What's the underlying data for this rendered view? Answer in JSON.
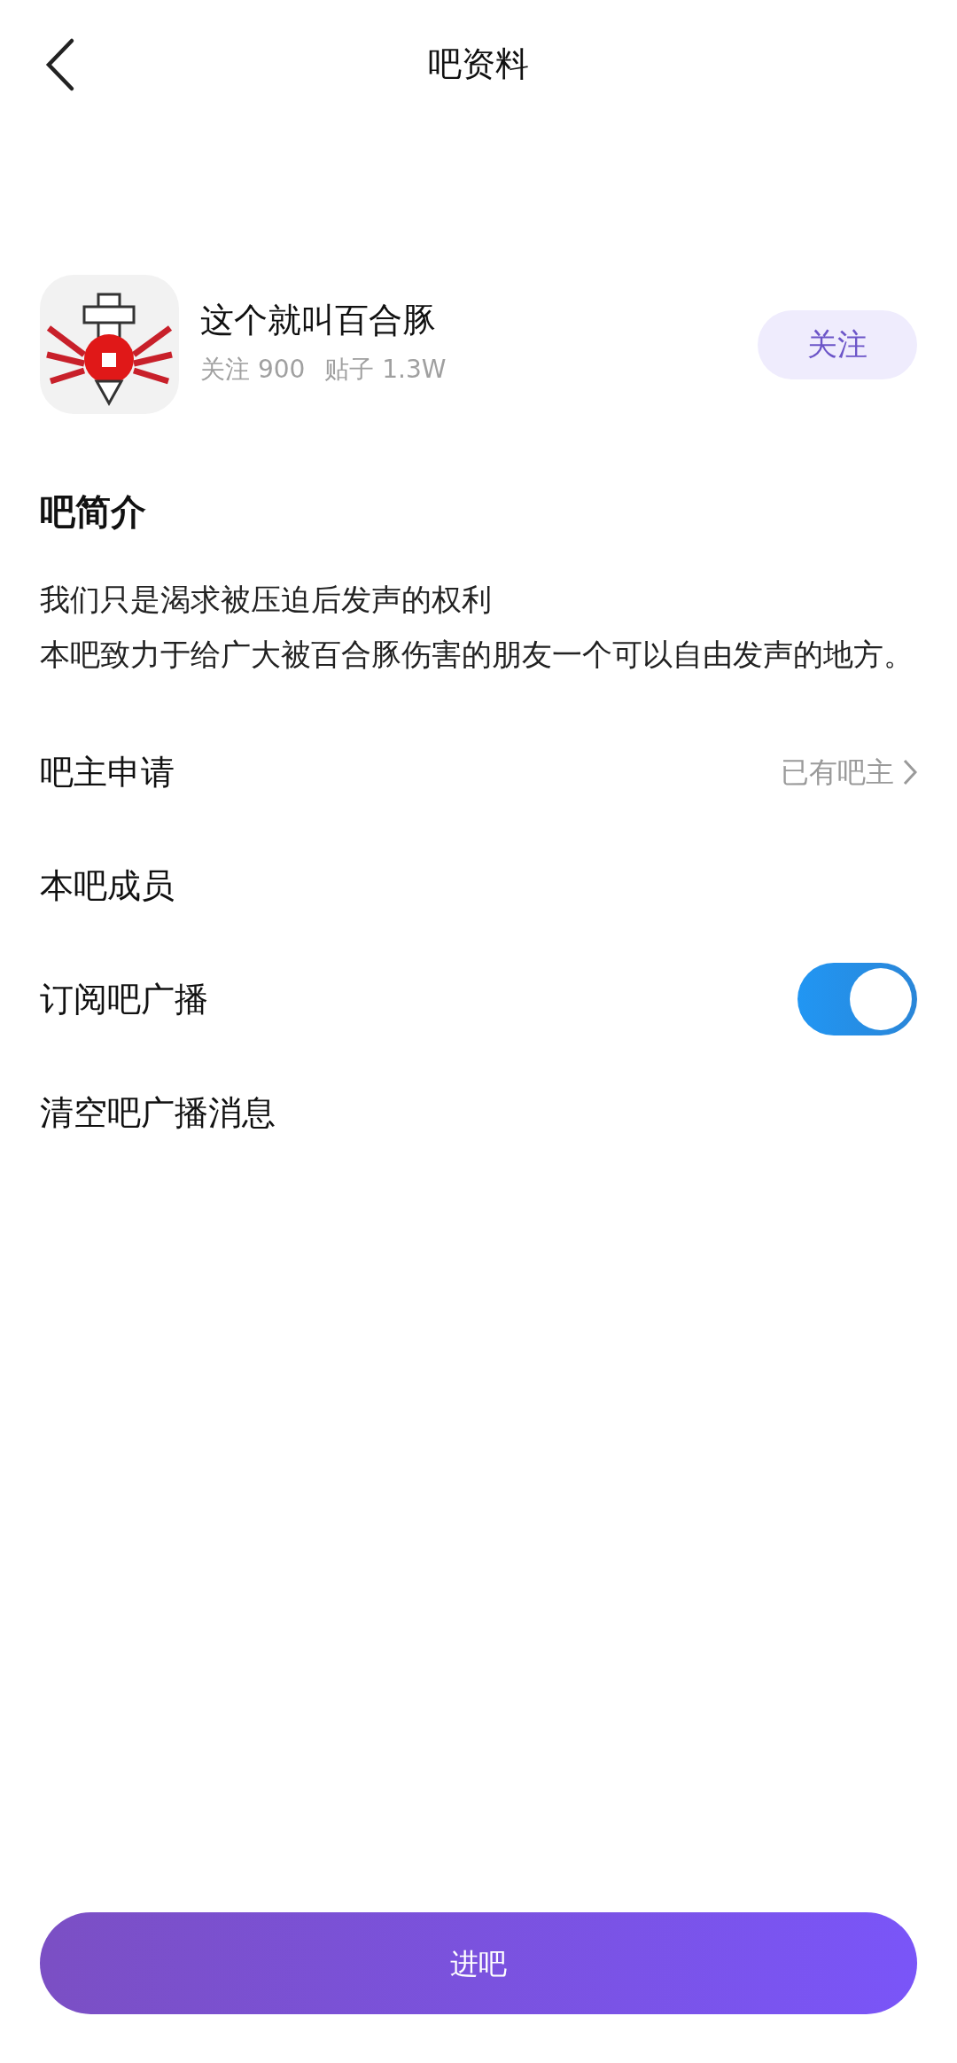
{
  "header": {
    "title": "吧资料"
  },
  "forum": {
    "name": "这个就叫百合豚",
    "followers": "关注 900",
    "posts": "贴子 1.3W",
    "follow_button": "关注"
  },
  "intro": {
    "heading": "吧简介",
    "lines": [
      "我们只是渴求被压迫后发声的权利",
      "本吧致力于给广大被百合豚伤害的朋友一个可以自由发声的地方。"
    ]
  },
  "rows": [
    {
      "kind": "link",
      "label": "吧主申请",
      "value": "已有吧主"
    },
    {
      "kind": "plain",
      "label": "本吧成员"
    },
    {
      "kind": "toggle",
      "label": "订阅吧广播",
      "on": true
    },
    {
      "kind": "plain",
      "label": "清空吧广播消息"
    }
  ],
  "enter_button": "进吧"
}
